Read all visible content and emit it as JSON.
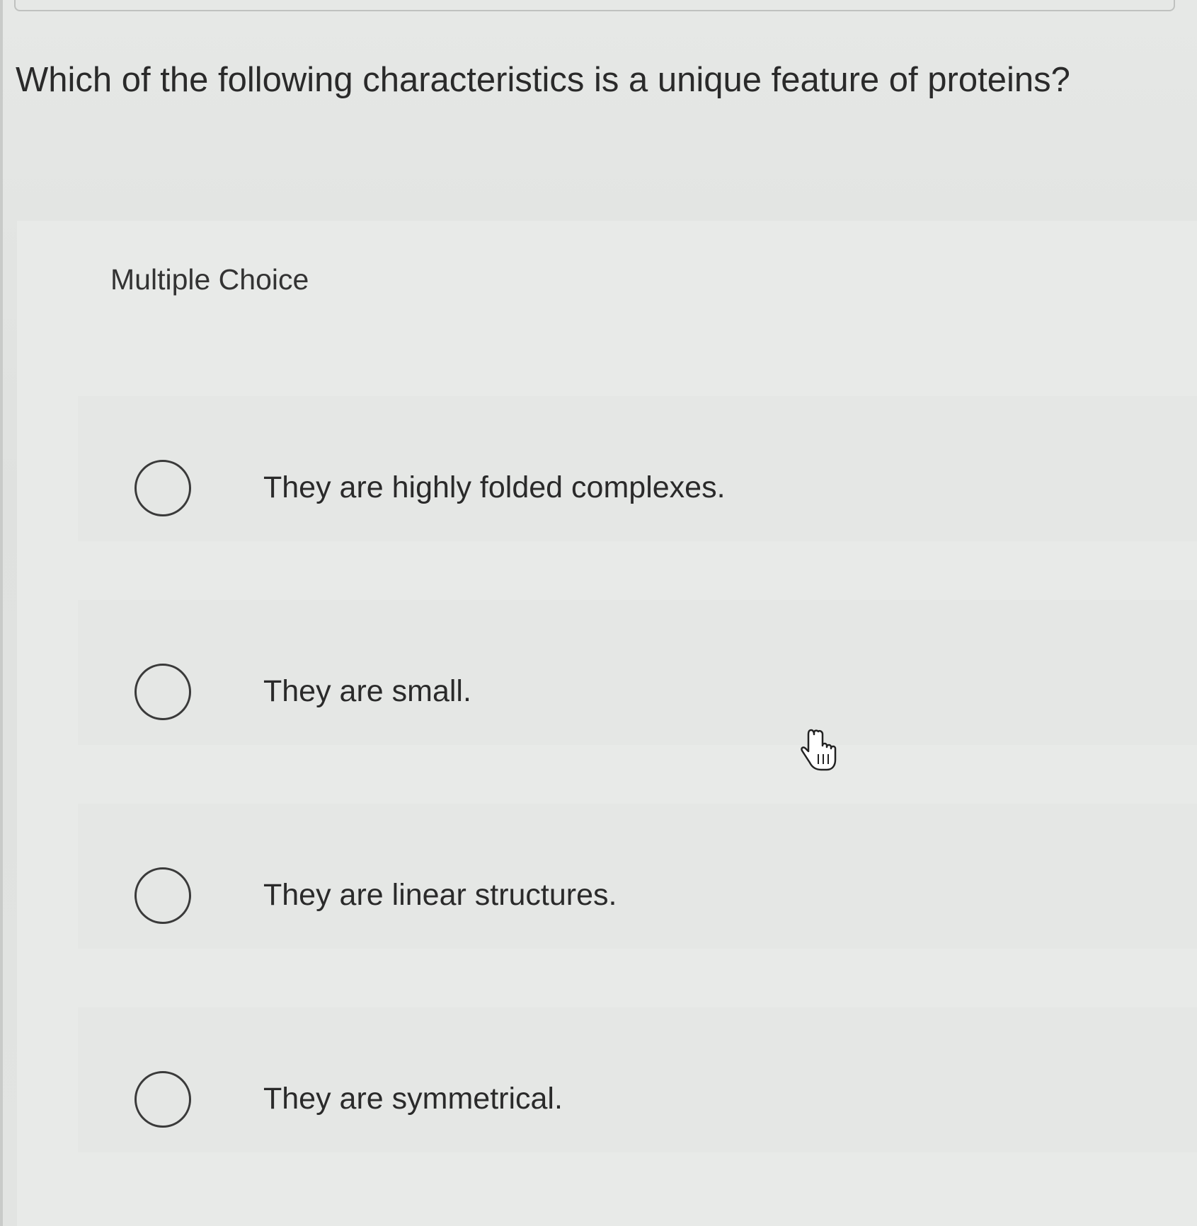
{
  "question": {
    "text": "Which of the following characteristics is a unique feature of proteins?"
  },
  "section": {
    "label": "Multiple Choice"
  },
  "options": [
    {
      "label": "They are highly folded complexes.",
      "selected": false
    },
    {
      "label": "They are small.",
      "selected": false
    },
    {
      "label": "They are linear structures.",
      "selected": false
    },
    {
      "label": "They are symmetrical.",
      "selected": false
    }
  ],
  "cursor": {
    "icon": "hand-pointer-icon"
  },
  "colors": {
    "background": "#e3e5e3",
    "text": "#2a2a2a",
    "radio_border": "#3a3a3a"
  }
}
